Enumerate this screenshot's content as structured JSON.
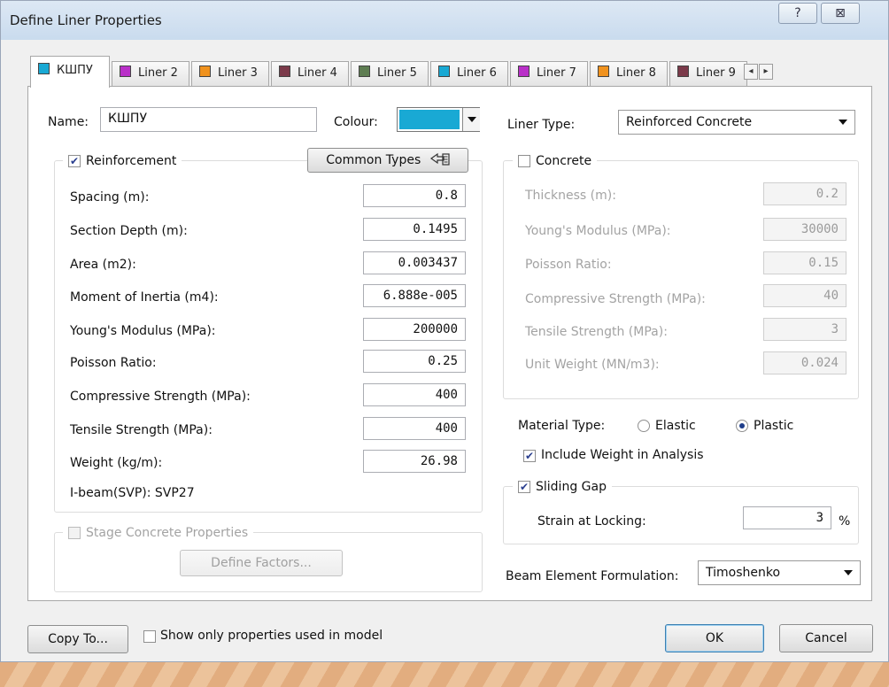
{
  "window": {
    "title": "Define Liner Properties",
    "help_glyph": "?",
    "close_glyph": "⊠"
  },
  "tabs": [
    {
      "label": "КШПУ",
      "color": "#19a9d4"
    },
    {
      "label": "Liner 2",
      "color": "#b92fc8"
    },
    {
      "label": "Liner 3",
      "color": "#f0921e"
    },
    {
      "label": "Liner 4",
      "color": "#7b3a4a"
    },
    {
      "label": "Liner 5",
      "color": "#5e7d52"
    },
    {
      "label": "Liner 6",
      "color": "#19a9d4"
    },
    {
      "label": "Liner 7",
      "color": "#b92fc8"
    },
    {
      "label": "Liner 8",
      "color": "#f0921e"
    },
    {
      "label": "Liner 9",
      "color": "#7b3a4a"
    }
  ],
  "tab_scroll": {
    "left": "◂",
    "right": "▸"
  },
  "name_label": "Name:",
  "name_value": "КШПУ",
  "colour_label": "Colour:",
  "colour_value": "#19a9d4",
  "reinforcement": {
    "label": "Reinforcement",
    "checked": true,
    "common_types_label": "Common Types",
    "fields": [
      {
        "label": "Spacing (m):",
        "value": "0.8"
      },
      {
        "label": "Section Depth (m):",
        "value": "0.1495"
      },
      {
        "label": "Area (m2):",
        "value": "0.003437"
      },
      {
        "label": "Moment of Inertia (m4):",
        "value": "6.888e-005"
      },
      {
        "label": "Young's Modulus (MPa):",
        "value": "200000"
      },
      {
        "label": "Poisson Ratio:",
        "value": "0.25"
      },
      {
        "label": "Compressive Strength (MPa):",
        "value": "400"
      },
      {
        "label": "Tensile Strength (MPa):",
        "value": "400"
      },
      {
        "label": "Weight (kg/m):",
        "value": "26.98"
      }
    ],
    "ibeam_text": "I-beam(SVP): SVP27"
  },
  "stage_concrete": {
    "label": "Stage Concrete Properties",
    "define_factors_label": "Define Factors..."
  },
  "liner_type": {
    "label": "Liner Type:",
    "value": "Reinforced Concrete"
  },
  "concrete": {
    "label": "Concrete",
    "checked": false,
    "fields": [
      {
        "label": "Thickness (m):",
        "value": "0.2"
      },
      {
        "label": "Young's Modulus (MPa):",
        "value": "30000"
      },
      {
        "label": "Poisson Ratio:",
        "value": "0.15"
      },
      {
        "label": "Compressive Strength (MPa):",
        "value": "40"
      },
      {
        "label": "Tensile Strength (MPa):",
        "value": "3"
      },
      {
        "label": "Unit Weight (MN/m3):",
        "value": "0.024"
      }
    ]
  },
  "material_type": {
    "label": "Material Type:",
    "elastic": "Elastic",
    "plastic": "Plastic",
    "selected": "Plastic"
  },
  "include_weight": {
    "label": "Include Weight in Analysis",
    "checked": true
  },
  "sliding_gap": {
    "label": "Sliding Gap",
    "checked": true,
    "strain_label": "Strain at Locking:",
    "strain_value": "3",
    "unit": "%"
  },
  "beam_formulation": {
    "label": "Beam Element Formulation:",
    "value": "Timoshenko"
  },
  "footer": {
    "copy_to": "Copy To...",
    "show_only": "Show only properties used in model",
    "ok": "OK",
    "cancel": "Cancel"
  }
}
